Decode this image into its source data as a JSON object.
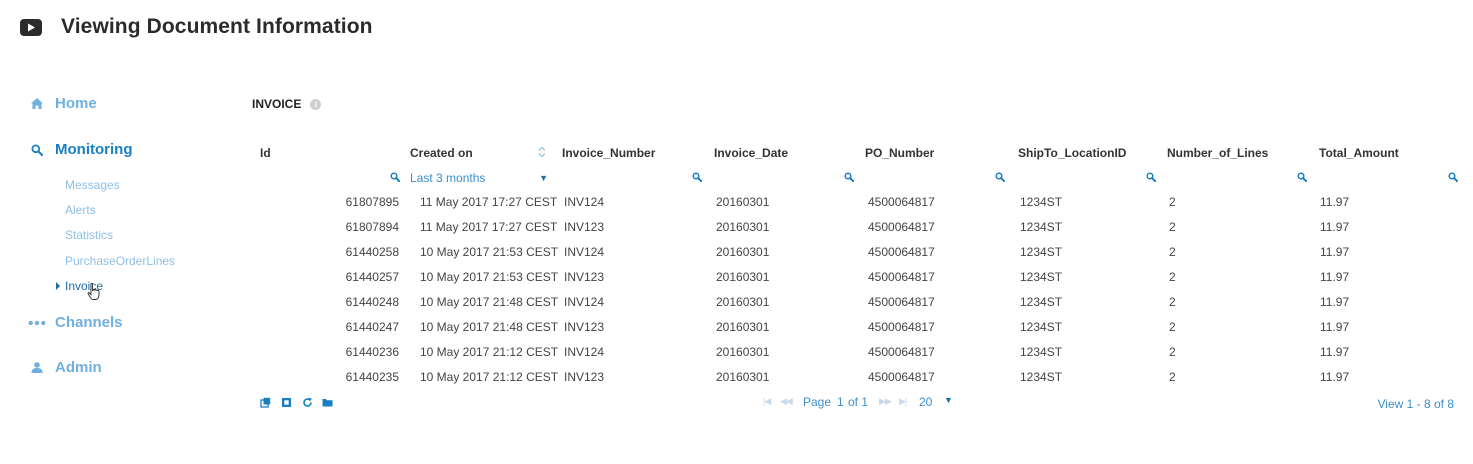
{
  "header": {
    "title": "Viewing Document Information"
  },
  "sidebar": {
    "main": [
      {
        "label": "Home"
      },
      {
        "label": "Monitoring"
      },
      {
        "label": "Channels"
      },
      {
        "label": "Admin"
      }
    ],
    "monitoring_items": [
      {
        "label": "Messages"
      },
      {
        "label": "Alerts"
      },
      {
        "label": "Statistics"
      },
      {
        "label": "PurchaseOrderLines"
      },
      {
        "label": "Invoice"
      }
    ]
  },
  "section": {
    "title": "INVOICE"
  },
  "table": {
    "columns": [
      "Id",
      "Created on",
      "Invoice_Number",
      "Invoice_Date",
      "PO_Number",
      "ShipTo_LocationID",
      "Number_of_Lines",
      "Total_Amount"
    ],
    "created_filter": "Last 3 months",
    "rows": [
      [
        "61807895",
        "11 May 2017 17:27 CEST",
        "INV124",
        "20160301",
        "4500064817",
        "1234ST",
        "2",
        "11.97"
      ],
      [
        "61807894",
        "11 May 2017 17:27 CEST",
        "INV123",
        "20160301",
        "4500064817",
        "1234ST",
        "2",
        "11.97"
      ],
      [
        "61440258",
        "10 May 2017 21:53 CEST",
        "INV124",
        "20160301",
        "4500064817",
        "1234ST",
        "2",
        "11.97"
      ],
      [
        "61440257",
        "10 May 2017 21:53 CEST",
        "INV123",
        "20160301",
        "4500064817",
        "1234ST",
        "2",
        "11.97"
      ],
      [
        "61440248",
        "10 May 2017 21:48 CEST",
        "INV124",
        "20160301",
        "4500064817",
        "1234ST",
        "2",
        "11.97"
      ],
      [
        "61440247",
        "10 May 2017 21:48 CEST",
        "INV123",
        "20160301",
        "4500064817",
        "1234ST",
        "2",
        "11.97"
      ],
      [
        "61440236",
        "10 May 2017 21:12 CEST",
        "INV124",
        "20160301",
        "4500064817",
        "1234ST",
        "2",
        "11.97"
      ],
      [
        "61440235",
        "10 May 2017 21:12 CEST",
        "INV123",
        "20160301",
        "4500064817",
        "1234ST",
        "2",
        "11.97"
      ]
    ]
  },
  "pager": {
    "page_label": "Page",
    "page_value": "1",
    "of_label": "of 1",
    "rows_per_page": "20",
    "view_text": "View 1 - 8 of 8"
  },
  "colors": {
    "accent": "#1a7fc1",
    "link": "#3c8dcb",
    "muted_link": "#8ec0e6",
    "title": "#2b2b2b"
  },
  "icons": {
    "header": "video-play-icon",
    "home": "home-icon",
    "monitoring": "search-icon",
    "channels": "dots-icon",
    "admin": "user-icon",
    "pager": [
      "export-icon",
      "stop-icon",
      "refresh-icon",
      "folder-icon"
    ]
  }
}
